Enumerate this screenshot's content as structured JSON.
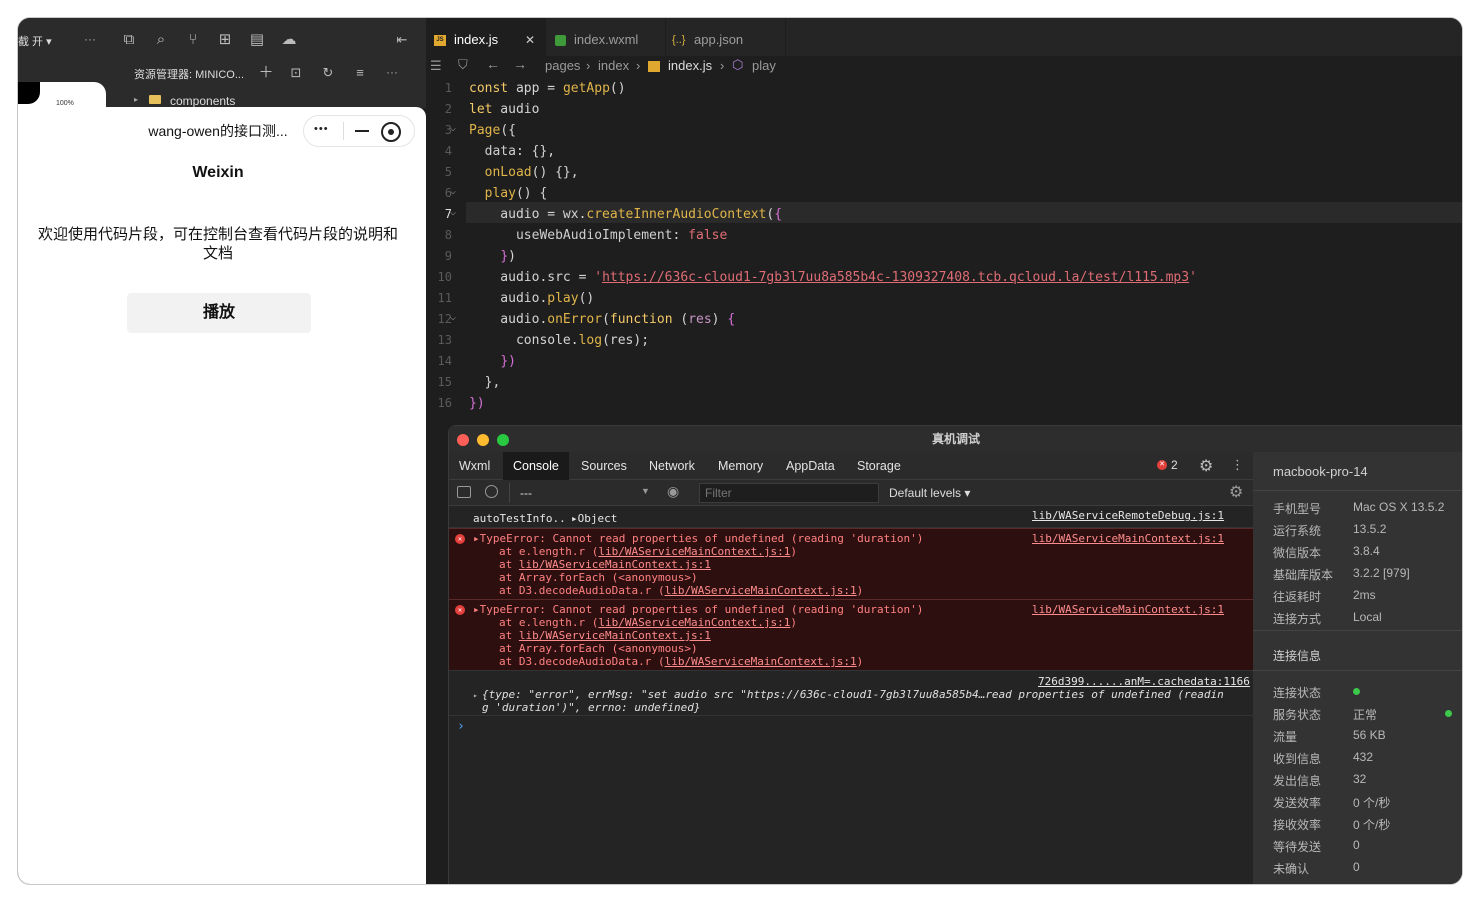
{
  "left_toolbar": {
    "drop_label": "截 开 ▾",
    "more": "···",
    "explorer_label": "资源管理器: MINICO...",
    "explorer_more": "···",
    "tree_folder": "components",
    "battery": "100%"
  },
  "simulator": {
    "title": "wang-owen的接口测...",
    "capsule_more": "•••",
    "heading": "Weixin",
    "description": "欢迎使用代码片段，可在控制台查看代码片段的说明和文档",
    "play_button": "播放"
  },
  "editor": {
    "tabs": [
      {
        "label": "index.js",
        "badge": "JS"
      },
      {
        "label": "index.wxml",
        "badge": ""
      },
      {
        "label": "app.json",
        "badge": "{..}"
      }
    ],
    "tab_close": "✕",
    "breadcrumbs": [
      "pages",
      "index",
      "index.js",
      "play"
    ],
    "lines": [
      "1",
      "2",
      "3",
      "4",
      "5",
      "6",
      "7",
      "8",
      "9",
      "10",
      "11",
      "12",
      "13",
      "14",
      "15",
      "16"
    ]
  },
  "devtools": {
    "title": "真机调试",
    "tabs": [
      "Wxml",
      "Console",
      "Sources",
      "Network",
      "Memory",
      "AppData",
      "Storage"
    ],
    "active_tab": "Console",
    "error_count": "2",
    "context": "---",
    "filter_placeholder": "Filter",
    "levels": "Default levels ▾",
    "console": {
      "log1": {
        "text": "autoTestInfo.. ",
        "object": "▸Object",
        "source": "lib/WAServiceRemoteDebug.js:1"
      },
      "error1": {
        "message": "▸TypeError: Cannot read properties of undefined (reading 'duration')",
        "source": "lib/WAServiceMainContext.js:1",
        "stack": [
          {
            "pre": "at e.length.r (",
            "link": "lib/WAServiceMainContext.js:1",
            "post": ")"
          },
          {
            "pre": "at ",
            "link": "lib/WAServiceMainContext.js:1",
            "post": ""
          },
          {
            "pre": "at Array.forEach (<anonymous>)",
            "link": "",
            "post": ""
          },
          {
            "pre": "at D3.decodeAudioData.r (",
            "link": "lib/WAServiceMainContext.js:1",
            "post": ")"
          }
        ]
      },
      "error2": {
        "message": "▸TypeError: Cannot read properties of undefined (reading 'duration')",
        "source": "lib/WAServiceMainContext.js:1",
        "stack": [
          {
            "pre": "at e.length.r (",
            "link": "lib/WAServiceMainContext.js:1",
            "post": ")"
          },
          {
            "pre": "at ",
            "link": "lib/WAServiceMainContext.js:1",
            "post": ""
          },
          {
            "pre": "at Array.forEach (<anonymous>)",
            "link": "",
            "post": ""
          },
          {
            "pre": "at D3.decodeAudioData.r (",
            "link": "lib/WAServiceMainContext.js:1",
            "post": ")"
          }
        ]
      },
      "log2": {
        "source": "726d399......anM=.cachedata:1166",
        "line1": "{type: \"error\", errMsg: \"set audio src \"https://636c-cloud1-7gb3l7uu8a585b4…read properties of undefined (readin",
        "line2": "g 'duration')\", errno: undefined}"
      },
      "prompt": "›"
    }
  },
  "device_panel": {
    "device_name": "macbook-pro-14",
    "info": [
      {
        "key": "手机型号",
        "value": "Mac OS X 13.5.2"
      },
      {
        "key": "运行系统",
        "value": "13.5.2"
      },
      {
        "key": "微信版本",
        "value": "3.8.4"
      },
      {
        "key": "基础库版本",
        "value": "3.2.2 [979]"
      },
      {
        "key": "往返耗时",
        "value": "2ms"
      },
      {
        "key": "连接方式",
        "value": "Local"
      }
    ],
    "section_title": "连接信息",
    "stats": [
      {
        "key": "连接状态",
        "value": ""
      },
      {
        "key": "服务状态",
        "value": "正常"
      },
      {
        "key": "流量",
        "value": "56 KB"
      },
      {
        "key": "收到信息",
        "value": "432"
      },
      {
        "key": "发出信息",
        "value": "32"
      },
      {
        "key": "发送效率",
        "value": "0 个/秒"
      },
      {
        "key": "接收效率",
        "value": "0 个/秒"
      },
      {
        "key": "等待发送",
        "value": "0"
      },
      {
        "key": "未确认",
        "value": "0"
      }
    ],
    "status_color": "#3cc84a"
  }
}
